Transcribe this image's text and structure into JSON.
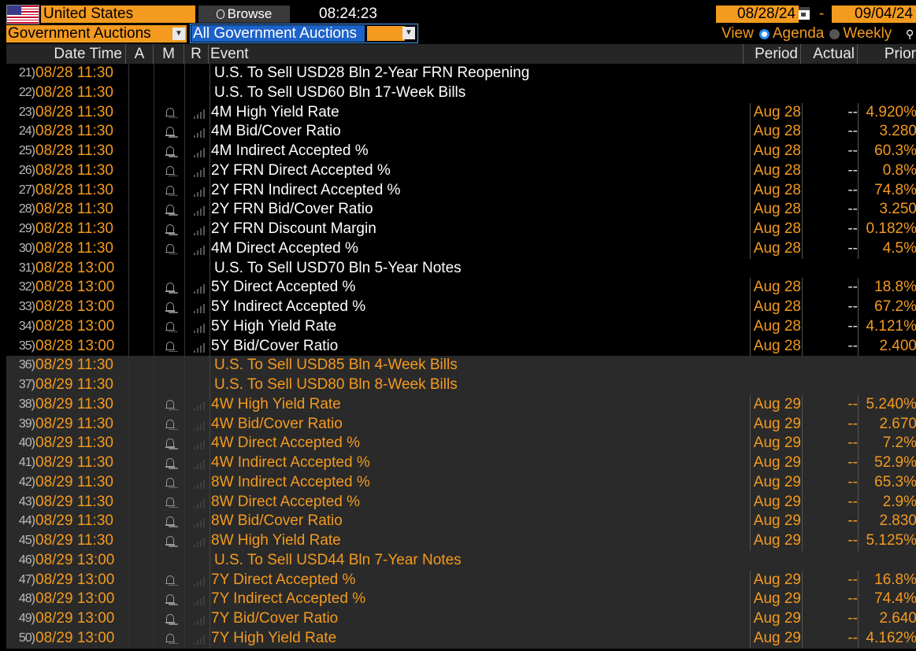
{
  "header": {
    "country": "United States",
    "browse_label": "Browse",
    "time": "08:24:23",
    "date_start": "08/28/24",
    "date_end": "09/04/24",
    "date_separator": "-"
  },
  "filters": {
    "category": "Government Auctions",
    "auction": "All Government Auctions",
    "view_label": "View",
    "view_agenda": "Agenda",
    "view_weekly": "Weekly",
    "selected_view": "Agenda"
  },
  "columns": {
    "datetime": "Date Time",
    "a": "A",
    "m": "M",
    "r": "R",
    "event": "Event",
    "period": "Period",
    "actual": "Actual",
    "prior": "Prior"
  },
  "rows": [
    {
      "num": "21)",
      "dt": "08/28 11:30",
      "event": "U.S. To Sell USD28 Bln 2-Year FRN Reopening",
      "period": "",
      "actual": "",
      "prior": "",
      "header": true,
      "shade": "dark"
    },
    {
      "num": "22)",
      "dt": "08/28 11:30",
      "event": "U.S. To Sell USD60 Bln 17-Week Bills",
      "period": "",
      "actual": "",
      "prior": "",
      "header": true,
      "shade": "dark"
    },
    {
      "num": "23)",
      "dt": "08/28 11:30",
      "event": "4M High Yield Rate",
      "period": "Aug 28",
      "actual": "--",
      "prior": "4.920%",
      "header": false,
      "shade": "dark"
    },
    {
      "num": "24)",
      "dt": "08/28 11:30",
      "event": "4M Bid/Cover Ratio",
      "period": "Aug 28",
      "actual": "--",
      "prior": "3.280",
      "header": false,
      "shade": "dark"
    },
    {
      "num": "25)",
      "dt": "08/28 11:30",
      "event": "4M Indirect Accepted %",
      "period": "Aug 28",
      "actual": "--",
      "prior": "60.3%",
      "header": false,
      "shade": "dark"
    },
    {
      "num": "26)",
      "dt": "08/28 11:30",
      "event": "2Y FRN Direct Accepted %",
      "period": "Aug 28",
      "actual": "--",
      "prior": "0.8%",
      "header": false,
      "shade": "dark"
    },
    {
      "num": "27)",
      "dt": "08/28 11:30",
      "event": "2Y FRN Indirect Accepted %",
      "period": "Aug 28",
      "actual": "--",
      "prior": "74.8%",
      "header": false,
      "shade": "dark"
    },
    {
      "num": "28)",
      "dt": "08/28 11:30",
      "event": "2Y FRN Bid/Cover Ratio",
      "period": "Aug 28",
      "actual": "--",
      "prior": "3.250",
      "header": false,
      "shade": "dark"
    },
    {
      "num": "29)",
      "dt": "08/28 11:30",
      "event": "2Y FRN Discount Margin",
      "period": "Aug 28",
      "actual": "--",
      "prior": "0.182%",
      "header": false,
      "shade": "dark"
    },
    {
      "num": "30)",
      "dt": "08/28 11:30",
      "event": "4M Direct Accepted %",
      "period": "Aug 28",
      "actual": "--",
      "prior": "4.5%",
      "header": false,
      "shade": "dark"
    },
    {
      "num": "31)",
      "dt": "08/28 13:00",
      "event": "U.S. To Sell USD70 Bln 5-Year Notes",
      "period": "",
      "actual": "",
      "prior": "",
      "header": true,
      "shade": "dark"
    },
    {
      "num": "32)",
      "dt": "08/28 13:00",
      "event": "5Y Direct Accepted %",
      "period": "Aug 28",
      "actual": "--",
      "prior": "18.8%",
      "header": false,
      "shade": "dark"
    },
    {
      "num": "33)",
      "dt": "08/28 13:00",
      "event": "5Y Indirect Accepted %",
      "period": "Aug 28",
      "actual": "--",
      "prior": "67.2%",
      "header": false,
      "shade": "dark"
    },
    {
      "num": "34)",
      "dt": "08/28 13:00",
      "event": "5Y High Yield Rate",
      "period": "Aug 28",
      "actual": "--",
      "prior": "4.121%",
      "header": false,
      "shade": "dark"
    },
    {
      "num": "35)",
      "dt": "08/28 13:00",
      "event": "5Y Bid/Cover Ratio",
      "period": "Aug 28",
      "actual": "--",
      "prior": "2.400",
      "header": false,
      "shade": "dark"
    },
    {
      "num": "36)",
      "dt": "08/29 11:30",
      "event": "U.S. To Sell USD85 Bln 4-Week Bills",
      "period": "",
      "actual": "",
      "prior": "",
      "header": true,
      "shade": "grey"
    },
    {
      "num": "37)",
      "dt": "08/29 11:30",
      "event": "U.S. To Sell USD80 Bln 8-Week Bills",
      "period": "",
      "actual": "",
      "prior": "",
      "header": true,
      "shade": "grey"
    },
    {
      "num": "38)",
      "dt": "08/29 11:30",
      "event": "4W High Yield Rate",
      "period": "Aug 29",
      "actual": "--",
      "prior": "5.240%",
      "header": false,
      "shade": "grey"
    },
    {
      "num": "39)",
      "dt": "08/29 11:30",
      "event": "4W Bid/Cover Ratio",
      "period": "Aug 29",
      "actual": "--",
      "prior": "2.670",
      "header": false,
      "shade": "grey"
    },
    {
      "num": "40)",
      "dt": "08/29 11:30",
      "event": "4W Direct Accepted %",
      "period": "Aug 29",
      "actual": "--",
      "prior": "7.2%",
      "header": false,
      "shade": "grey"
    },
    {
      "num": "41)",
      "dt": "08/29 11:30",
      "event": "4W Indirect Accepted %",
      "period": "Aug 29",
      "actual": "--",
      "prior": "52.9%",
      "header": false,
      "shade": "grey"
    },
    {
      "num": "42)",
      "dt": "08/29 11:30",
      "event": "8W Indirect Accepted %",
      "period": "Aug 29",
      "actual": "--",
      "prior": "65.3%",
      "header": false,
      "shade": "grey"
    },
    {
      "num": "43)",
      "dt": "08/29 11:30",
      "event": "8W Direct Accepted %",
      "period": "Aug 29",
      "actual": "--",
      "prior": "2.9%",
      "header": false,
      "shade": "grey"
    },
    {
      "num": "44)",
      "dt": "08/29 11:30",
      "event": "8W Bid/Cover Ratio",
      "period": "Aug 29",
      "actual": "--",
      "prior": "2.830",
      "header": false,
      "shade": "grey"
    },
    {
      "num": "45)",
      "dt": "08/29 11:30",
      "event": "8W High Yield Rate",
      "period": "Aug 29",
      "actual": "--",
      "prior": "5.125%",
      "header": false,
      "shade": "grey"
    },
    {
      "num": "46)",
      "dt": "08/29 13:00",
      "event": "U.S. To Sell USD44 Bln 7-Year Notes",
      "period": "",
      "actual": "",
      "prior": "",
      "header": true,
      "shade": "grey"
    },
    {
      "num": "47)",
      "dt": "08/29 13:00",
      "event": "7Y Direct Accepted %",
      "period": "Aug 29",
      "actual": "--",
      "prior": "16.8%",
      "header": false,
      "shade": "grey"
    },
    {
      "num": "48)",
      "dt": "08/29 13:00",
      "event": "7Y Indirect Accepted %",
      "period": "Aug 29",
      "actual": "--",
      "prior": "74.4%",
      "header": false,
      "shade": "grey"
    },
    {
      "num": "49)",
      "dt": "08/29 13:00",
      "event": "7Y Bid/Cover Ratio",
      "period": "Aug 29",
      "actual": "--",
      "prior": "2.640",
      "header": false,
      "shade": "grey"
    },
    {
      "num": "50)",
      "dt": "08/29 13:00",
      "event": "7Y High Yield Rate",
      "period": "Aug 29",
      "actual": "--",
      "prior": "4.162%",
      "header": false,
      "shade": "grey"
    }
  ],
  "icons": {
    "alert": "bell-icon",
    "relevance": "signal-bars-icon",
    "flag": "us-flag-icon",
    "calendar": "calendar-icon"
  },
  "colors": {
    "accent": "#f39a1f",
    "selection": "#1d62c8",
    "background": "#000000",
    "grey_row": "#2a2a2a"
  }
}
